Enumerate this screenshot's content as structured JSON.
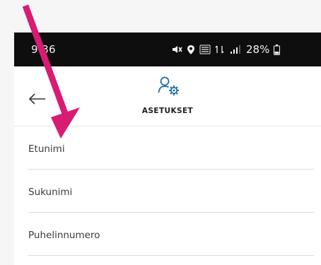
{
  "status_bar": {
    "time": "9:36",
    "battery": "28%"
  },
  "header": {
    "title": "ASETUKSET"
  },
  "form": {
    "fields": [
      {
        "label": "Etunimi"
      },
      {
        "label": "Sukunimi"
      },
      {
        "label": "Puhelinnumero"
      }
    ]
  },
  "colors": {
    "accent": "#1f6fa8",
    "arrow": "#d81b73",
    "status_bar_bg": "#0e0e0e"
  },
  "icons": {
    "back": "arrow-left-icon",
    "settings": "user-settings-icon"
  }
}
